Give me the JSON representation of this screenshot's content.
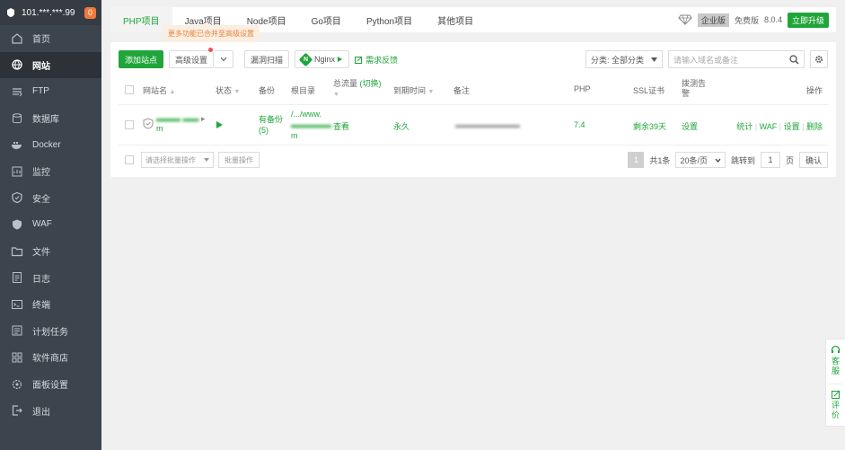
{
  "sidebar": {
    "host": "101.***.***.99",
    "badge": "0",
    "items": [
      {
        "label": "首页",
        "icon": "home-icon"
      },
      {
        "label": "网站",
        "icon": "globe-icon",
        "active": true
      },
      {
        "label": "FTP",
        "icon": "ftp-icon"
      },
      {
        "label": "数据库",
        "icon": "database-icon"
      },
      {
        "label": "Docker",
        "icon": "docker-icon"
      },
      {
        "label": "监控",
        "icon": "monitor-icon"
      },
      {
        "label": "安全",
        "icon": "shield-icon"
      },
      {
        "label": "WAF",
        "icon": "waf-icon"
      },
      {
        "label": "文件",
        "icon": "folder-icon"
      },
      {
        "label": "日志",
        "icon": "log-icon"
      },
      {
        "label": "终端",
        "icon": "terminal-icon"
      },
      {
        "label": "计划任务",
        "icon": "clock-icon"
      },
      {
        "label": "软件商店",
        "icon": "apps-icon"
      },
      {
        "label": "面板设置",
        "icon": "settings-icon"
      },
      {
        "label": "退出",
        "icon": "logout-icon"
      }
    ]
  },
  "tabs": [
    "PHP项目",
    "Java项目",
    "Node项目",
    "Go项目",
    "Python项目",
    "其他项目"
  ],
  "top_right": {
    "edition": "企业版",
    "free": "免费版",
    "version": "8.0.4",
    "upgrade": "立即升级"
  },
  "tooltip": "更多功能已合并至高级设置",
  "toolbar": {
    "add_site": "添加站点",
    "advanced": "高级设置",
    "vuln_scan": "漏洞扫描",
    "nginx": "Nginx",
    "feedback": "需求反馈",
    "category": "分类: 全部分类",
    "search_placeholder": "请输入域名或备注"
  },
  "table": {
    "headers": {
      "name": "网站名",
      "status": "状态",
      "backup": "备份",
      "root": "根目录",
      "traffic": "总流量",
      "traffic_switch": "(切换)",
      "expire": "到期时间",
      "note": "备注",
      "php": "PHP",
      "ssl": "SSL证书",
      "alert_1": "拨测告",
      "alert_2": "警",
      "ops": "操作"
    },
    "row": {
      "name_tail": "m",
      "backup_1": "有备份",
      "backup_2": "(5)",
      "root_1": "/.../www.",
      "root_3": "m",
      "traffic": "查看",
      "expire": "永久",
      "php": "7.4",
      "ssl": "剩余39天",
      "alert": "设置",
      "op_stats": "统计",
      "op_waf": "WAF",
      "op_settings": "设置",
      "op_delete": "删除"
    }
  },
  "footer": {
    "batch_placeholder": "请选择批量操作",
    "batch_button": "批量操作",
    "page": "1",
    "total": "共1条",
    "per_page": "20条/页",
    "goto": "跳转到",
    "goto_value": "1",
    "page_unit": "页",
    "confirm": "确认"
  },
  "float": {
    "service": "客服",
    "rate": "评价"
  },
  "colors": {
    "accent": "#20a53a",
    "sidebar": "#3c444d",
    "warning": "#f0783c"
  }
}
